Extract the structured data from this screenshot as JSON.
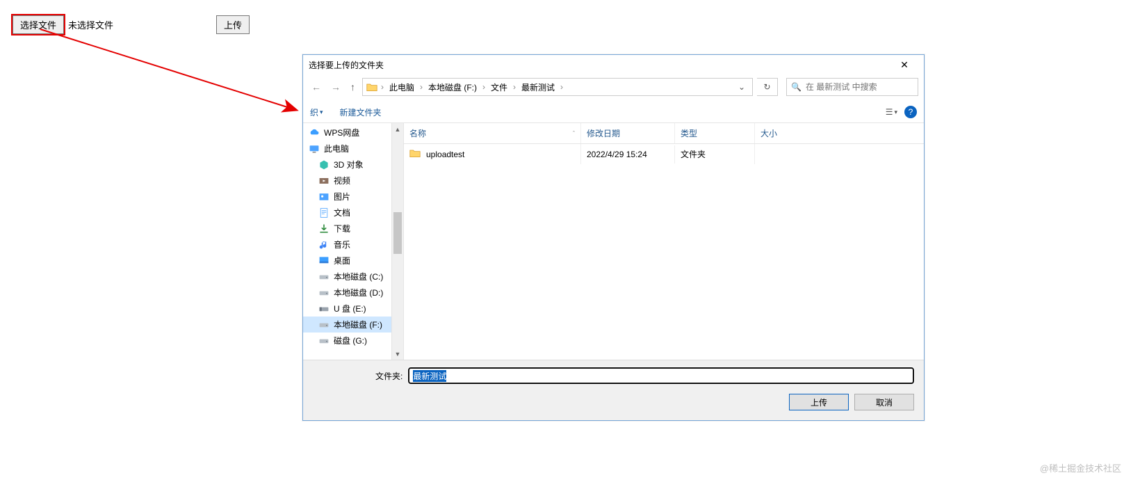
{
  "page": {
    "choose_label": "选择文件",
    "no_file_label": "未选择文件",
    "upload_label": "上传"
  },
  "dialog": {
    "title": "选择要上传的文件夹",
    "breadcrumb": [
      "此电脑",
      "本地磁盘 (F:)",
      "文件",
      "最新测试"
    ],
    "search_placeholder": "在 最新测试 中搜索",
    "toolbar": {
      "organize": "织",
      "new_folder": "新建文件夹"
    },
    "columns": {
      "name": "名称",
      "date": "修改日期",
      "type": "类型",
      "size": "大小"
    },
    "rows": [
      {
        "name": "uploadtest",
        "date": "2022/4/29 15:24",
        "type": "文件夹",
        "size": ""
      }
    ],
    "sidebar": [
      {
        "label": "WPS网盘",
        "icon": "cloud",
        "indent": false
      },
      {
        "label": "此电脑",
        "icon": "pc",
        "indent": false
      },
      {
        "label": "3D 对象",
        "icon": "3d",
        "indent": true
      },
      {
        "label": "视频",
        "icon": "video",
        "indent": true
      },
      {
        "label": "图片",
        "icon": "image",
        "indent": true
      },
      {
        "label": "文档",
        "icon": "doc",
        "indent": true
      },
      {
        "label": "下载",
        "icon": "download",
        "indent": true
      },
      {
        "label": "音乐",
        "icon": "music",
        "indent": true
      },
      {
        "label": "桌面",
        "icon": "desktop",
        "indent": true
      },
      {
        "label": "本地磁盘 (C:)",
        "icon": "disk",
        "indent": true
      },
      {
        "label": "本地磁盘 (D:)",
        "icon": "disk",
        "indent": true
      },
      {
        "label": "U 盘 (E:)",
        "icon": "usb",
        "indent": true
      },
      {
        "label": "本地磁盘 (F:)",
        "icon": "disk",
        "indent": true,
        "selected": true
      },
      {
        "label": "磁盘 (G:)",
        "icon": "disk",
        "indent": true
      }
    ],
    "folder_label": "文件夹:",
    "folder_value": "最新测试",
    "btn_upload": "上传",
    "btn_cancel": "取消"
  },
  "watermark": "@稀土掘金技术社区"
}
